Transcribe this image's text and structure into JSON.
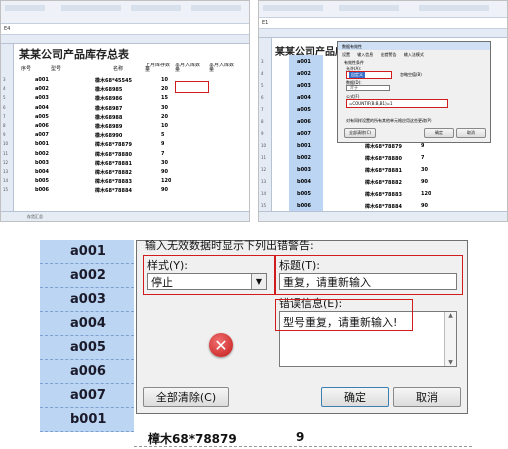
{
  "panel_left": {
    "cell_ref": "E4",
    "col_letters": [
      "A",
      "B",
      "C",
      "D",
      "E",
      "F"
    ],
    "title": "某某公司产品库存总表",
    "headers": {
      "seq": "序号",
      "model": "型号",
      "name": "名称",
      "stock": "上月库存数量",
      "in": "本月入库数量",
      "out": "本月入库数量"
    },
    "rows": [
      {
        "n": "1",
        "model": "",
        "name": "",
        "stock": ""
      },
      {
        "n": "2",
        "model": "",
        "name": "",
        "stock": ""
      },
      {
        "n": "3",
        "model": "a001",
        "name": "橡木68*45545",
        "stock": "10"
      },
      {
        "n": "4",
        "model": "a002",
        "name": "橡木68985",
        "stock": "20"
      },
      {
        "n": "5",
        "model": "a003",
        "name": "橡木68986",
        "stock": "15"
      },
      {
        "n": "6",
        "model": "a004",
        "name": "橡木68987",
        "stock": "30"
      },
      {
        "n": "7",
        "model": "a005",
        "name": "橡木68988",
        "stock": "20"
      },
      {
        "n": "8",
        "model": "a006",
        "name": "橡木68989",
        "stock": "10"
      },
      {
        "n": "9",
        "model": "a007",
        "name": "橡木68990",
        "stock": "5"
      },
      {
        "n": "10",
        "model": "b001",
        "name": "樟木68*78879",
        "stock": "9"
      },
      {
        "n": "11",
        "model": "b002",
        "name": "樟木68*78880",
        "stock": "7"
      },
      {
        "n": "12",
        "model": "b003",
        "name": "樟木68*78881",
        "stock": "30"
      },
      {
        "n": "13",
        "model": "b004",
        "name": "樟木68*78882",
        "stock": "90"
      },
      {
        "n": "14",
        "model": "b005",
        "name": "樟木68*78883",
        "stock": "120"
      },
      {
        "n": "15",
        "model": "b006",
        "name": "樟木68*78884",
        "stock": "90"
      }
    ],
    "sheet_tab": "存货汇总"
  },
  "panel_right": {
    "cell_ref": "E1",
    "title": "某某公司产品库",
    "dialog": {
      "title": "数据有效性",
      "tabs": [
        "设置",
        "输入信息",
        "出错警告",
        "输入法模式"
      ],
      "section": "有效性条件",
      "allow_label": "允许(A):",
      "allow_value": "自定义",
      "ignore_blank": "忽略空值(B)",
      "data_label": "数据(D):",
      "data_value": "介于",
      "formula_label": "公式(F)",
      "formula_value": "=COUNTIF(B:B,B1)=1",
      "apply_all": "对有同样设置的所有其他单元格应用这些更改(P)",
      "clear_all": "全部清除(C)",
      "ok": "确定",
      "cancel": "取消"
    },
    "rows": [
      {
        "n": "1",
        "model": "",
        "name": "",
        "stock": ""
      },
      {
        "n": "2",
        "model": "",
        "name": "",
        "stock": ""
      },
      {
        "n": "3",
        "model": "a001",
        "name": "",
        "stock": ""
      },
      {
        "n": "4",
        "model": "a002",
        "name": "",
        "stock": ""
      },
      {
        "n": "5",
        "model": "a003",
        "name": "",
        "stock": ""
      },
      {
        "n": "6",
        "model": "a004",
        "name": "",
        "stock": ""
      },
      {
        "n": "7",
        "model": "a005",
        "name": "",
        "stock": ""
      },
      {
        "n": "8",
        "model": "a006",
        "name": "",
        "stock": ""
      },
      {
        "n": "9",
        "model": "a007",
        "name": "",
        "stock": ""
      },
      {
        "n": "10",
        "model": "b001",
        "name": "樟木68*78879",
        "stock": "9"
      },
      {
        "n": "11",
        "model": "b002",
        "name": "樟木68*78880",
        "stock": "7"
      },
      {
        "n": "12",
        "model": "b003",
        "name": "樟木68*78881",
        "stock": "30"
      },
      {
        "n": "13",
        "model": "b004",
        "name": "樟木68*78882",
        "stock": "90"
      },
      {
        "n": "14",
        "model": "b005",
        "name": "樟木68*78883",
        "stock": "120"
      },
      {
        "n": "15",
        "model": "b006",
        "name": "樟木68*78884",
        "stock": "90"
      }
    ]
  },
  "zoom": {
    "header_text": "输入无效数据时显示下列出错警告:",
    "rows": [
      "a001",
      "a002",
      "a003",
      "a004",
      "a005",
      "a006",
      "a007",
      "b001"
    ],
    "style_label": "样式(Y):",
    "style_value": "停止",
    "title_label": "标题(T):",
    "title_value": "重复，请重新输入",
    "error_label": "错误信息(E):",
    "error_value": "型号重复，请重新输入!",
    "clear_all": "全部清除(C)",
    "ok": "确定",
    "cancel": "取消",
    "bottom_name": "樟木68*78879",
    "bottom_qty": "9"
  }
}
